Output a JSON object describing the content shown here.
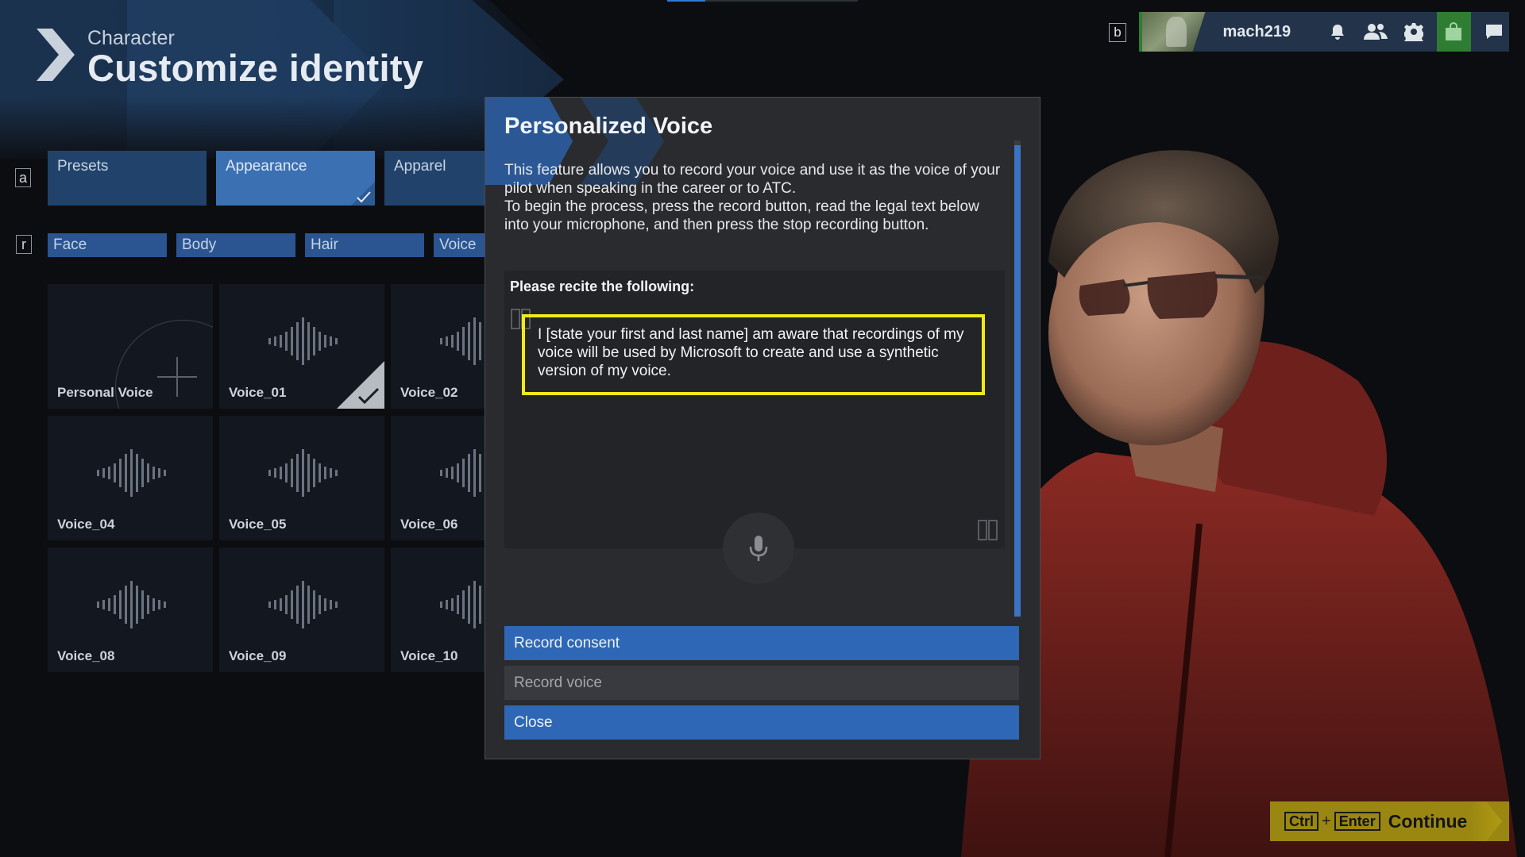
{
  "header": {
    "subtitle": "Character",
    "title": "Customize identity"
  },
  "userbar": {
    "key_hint": "b",
    "username": "mach219",
    "icons": [
      "bell-icon",
      "friends-icon",
      "gear-icon",
      "store-icon",
      "chat-icon"
    ]
  },
  "tabs": {
    "key_hint": "a",
    "items": [
      {
        "label": "Presets",
        "active": false
      },
      {
        "label": "Appearance",
        "active": true
      },
      {
        "label": "Apparel",
        "active": false
      }
    ]
  },
  "subtabs": {
    "key_hint": "r",
    "items": [
      {
        "label": "Face"
      },
      {
        "label": "Body"
      },
      {
        "label": "Hair"
      },
      {
        "label": "Voice"
      }
    ]
  },
  "voices": [
    {
      "label": "Personal Voice",
      "type": "add"
    },
    {
      "label": "Voice_01",
      "selected": true
    },
    {
      "label": "Voice_02"
    },
    {
      "label": "Voice_04"
    },
    {
      "label": "Voice_05"
    },
    {
      "label": "Voice_06"
    },
    {
      "label": "Voice_08"
    },
    {
      "label": "Voice_09"
    },
    {
      "label": "Voice_10"
    }
  ],
  "dialog": {
    "title": "Personalized Voice",
    "intro_1": "This feature allows you to record your voice and use it as the voice of your pilot when speaking in the career or to ATC.",
    "intro_2": "To begin the process, press the record button, read the legal text below into your microphone, and then press the stop recording button.",
    "recite_label": "Please recite the following:",
    "legal_text": "I [state your first and last name] am aware that recordings of my voice will be used by Microsoft to create and use a synthetic version of my voice.",
    "buttons": {
      "record_consent": "Record consent",
      "record_voice": "Record voice",
      "close": "Close"
    }
  },
  "continue": {
    "key1": "Ctrl",
    "plus": "+",
    "key2": "Enter",
    "label": "Continue"
  },
  "colors": {
    "accent_blue": "#2e67b5",
    "highlight_yellow": "#f2ea18",
    "continue_gold": "#9a8711",
    "online_green": "#2e7d32"
  }
}
